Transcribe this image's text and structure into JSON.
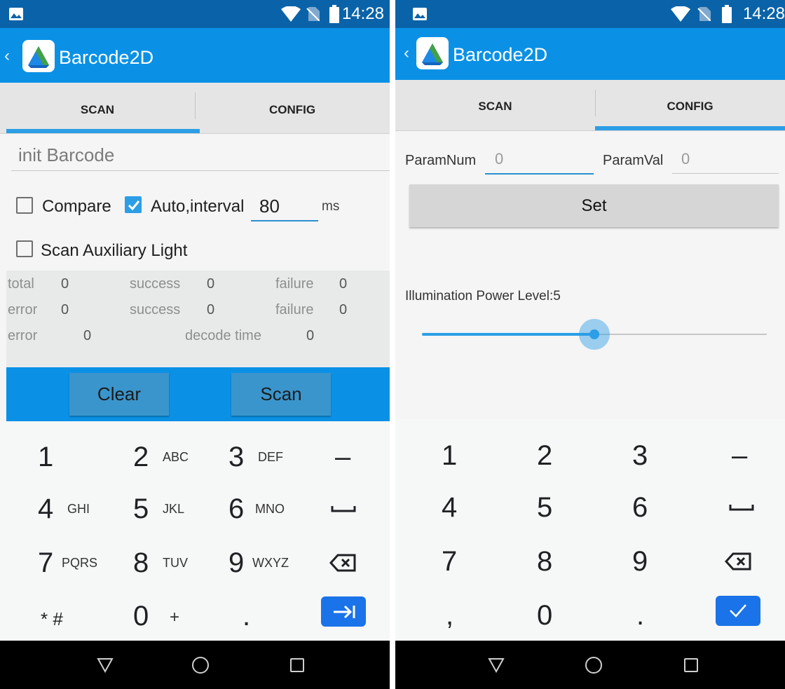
{
  "app": {
    "title": "Barcode2D",
    "time": "14:28"
  },
  "tabs": {
    "scan": "SCAN",
    "config": "CONFIG"
  },
  "scan": {
    "barcode_value": "init Barcode",
    "compare_label": "Compare",
    "compare_checked": false,
    "auto_label": "Auto,interval",
    "auto_checked": true,
    "interval_value": "80",
    "interval_unit": "ms",
    "aux_light_label": "Scan Auxiliary Light",
    "aux_light_checked": false,
    "stats": [
      [
        "total",
        "0",
        "success",
        "0",
        "failure",
        "0"
      ],
      [
        "error",
        "0",
        "success",
        "0",
        "failure",
        "0"
      ],
      [
        "error",
        "0",
        "decode time",
        "0"
      ]
    ],
    "clear_label": "Clear",
    "scan_label": "Scan"
  },
  "config": {
    "param_num_label": "ParamNum",
    "param_num_placeholder": "0",
    "param_val_label": "ParamVal",
    "param_val_placeholder": "0",
    "set_label": "Set",
    "illumination_label": "Illumination Power Level:5",
    "illumination_level_fraction": 0.5
  },
  "keyboard_phone": {
    "rows": [
      [
        {
          "main": "1",
          "sub": ""
        },
        {
          "main": "2",
          "sub": "ABC"
        },
        {
          "main": "3",
          "sub": "DEF"
        },
        {
          "main": "–",
          "sub": ""
        }
      ],
      [
        {
          "main": "4",
          "sub": "GHI"
        },
        {
          "main": "5",
          "sub": "JKL"
        },
        {
          "main": "6",
          "sub": "MNO"
        },
        {
          "main": "space",
          "sub": ""
        }
      ],
      [
        {
          "main": "7",
          "sub": "PQRS"
        },
        {
          "main": "8",
          "sub": "TUV"
        },
        {
          "main": "9",
          "sub": "WXYZ"
        },
        {
          "main": "backspace",
          "sub": ""
        }
      ],
      [
        {
          "main": "* #",
          "sub": ""
        },
        {
          "main": "0",
          "sub": "+"
        },
        {
          "main": ".",
          "sub": ""
        },
        {
          "main": "tab-next",
          "sub": ""
        }
      ]
    ]
  },
  "keyboard_number": {
    "rows": [
      [
        "1",
        "2",
        "3",
        "–"
      ],
      [
        "4",
        "5",
        "6",
        "space"
      ],
      [
        "7",
        "8",
        "9",
        "backspace"
      ],
      [
        ",",
        "0",
        ".",
        "done"
      ]
    ]
  },
  "icons": {
    "status_left": "image-icon",
    "wifi": "wifi-icon",
    "no_sim": "no-sim-icon",
    "battery": "battery-icon",
    "back": "back-arrow-icon",
    "app_logo": "app-logo-icon",
    "nav_back": "nav-back-icon",
    "nav_home": "nav-home-icon",
    "nav_recents": "nav-recents-icon"
  },
  "colors": {
    "status_bar": "#0a63a8",
    "app_bar": "#0a91e6",
    "accent": "#2c9ee6",
    "tab_bg": "#e5e5e5",
    "keyboard_action": "#1a73e8"
  }
}
